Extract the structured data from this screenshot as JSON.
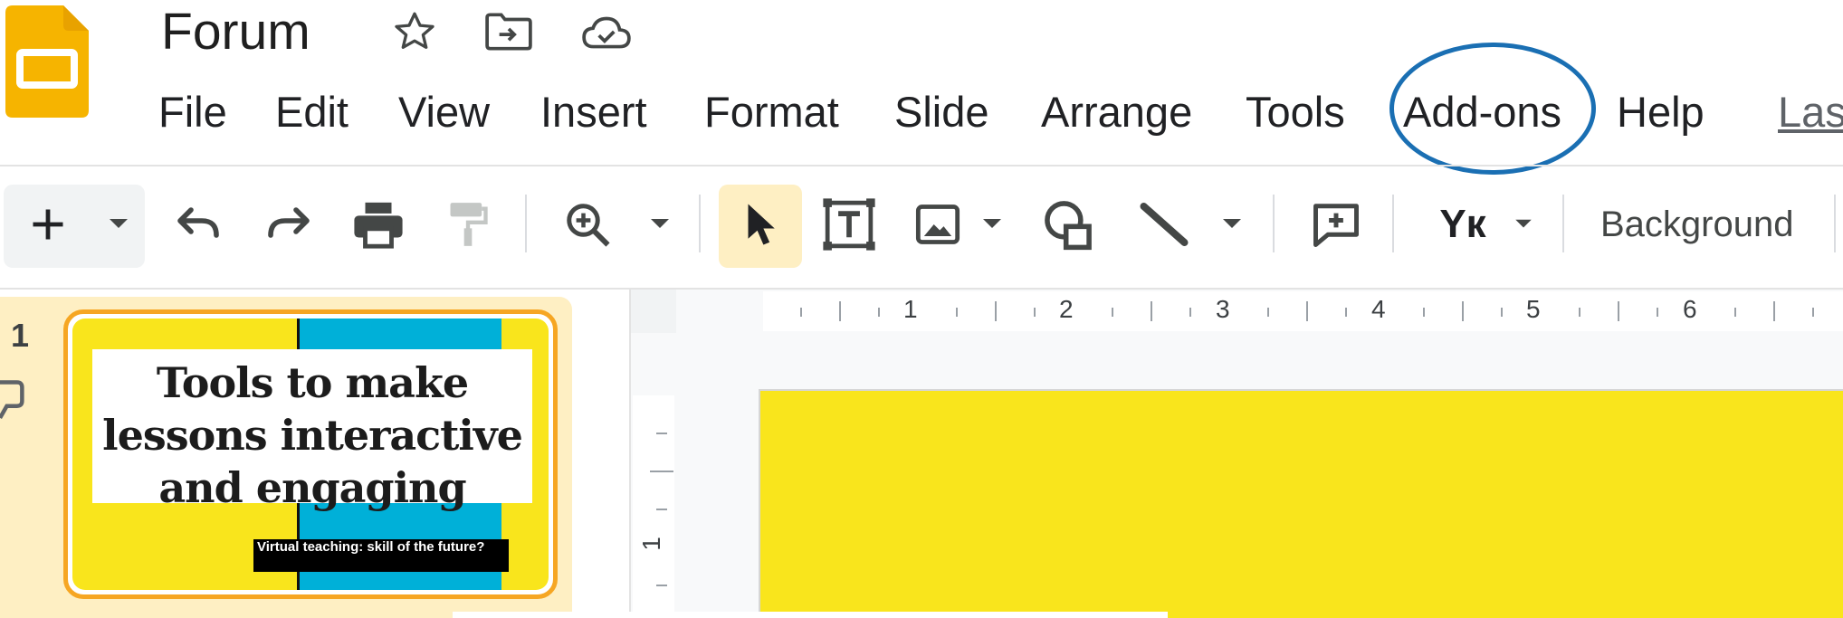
{
  "doc": {
    "title": "Forum"
  },
  "menu": {
    "file": "File",
    "edit": "Edit",
    "view": "View",
    "insert": "Insert",
    "format": "Format",
    "slide": "Slide",
    "arrange": "Arrange",
    "tools": "Tools",
    "addons": "Add-ons",
    "help": "Help",
    "last_edit": "Las"
  },
  "toolbar": {
    "background": "Background",
    "text_style_glyph": "Yк"
  },
  "filmstrip": {
    "slides": [
      {
        "number": "1",
        "title_lines": [
          "Tools to make",
          "lessons interactive",
          "and engaging"
        ],
        "subtitle": "Virtual teaching: skill of the future?"
      }
    ]
  },
  "ruler": {
    "h_labels": [
      "1",
      "2",
      "3",
      "4",
      "5",
      "6"
    ],
    "v_labels": [
      "1"
    ]
  },
  "colors": {
    "slide_yellow": "#f9e51c",
    "slide_cyan": "#00b0d8",
    "highlight_circle": "#1a6fb3",
    "thumb_border": "#f6a623",
    "filmstrip_bg": "#feefc3",
    "logo_yellow": "#f6b400"
  },
  "icons": {
    "app_logo": "google-slides-logo",
    "star": "star-icon",
    "move": "move-to-folder-icon",
    "cloud": "cloud-saved-icon"
  }
}
